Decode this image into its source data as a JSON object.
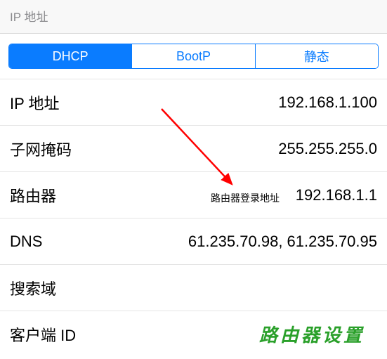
{
  "header": {
    "title": "IP 地址"
  },
  "segments": {
    "items": [
      "DHCP",
      "BootP",
      "静态"
    ],
    "selected_index": 0
  },
  "rows": [
    {
      "label": "IP 地址",
      "value": "192.168.1.100"
    },
    {
      "label": "子网掩码",
      "value": "255.255.255.0"
    },
    {
      "label": "路由器",
      "value": "192.168.1.1"
    },
    {
      "label": "DNS",
      "value": "61.235.70.98, 61.235.70.95"
    },
    {
      "label": "搜索域",
      "value": ""
    },
    {
      "label": "客户端 ID",
      "value": ""
    }
  ],
  "annotation": {
    "text": "路由器登录地址",
    "arrow_color": "#ff0000"
  },
  "watermark": "路由器设置"
}
